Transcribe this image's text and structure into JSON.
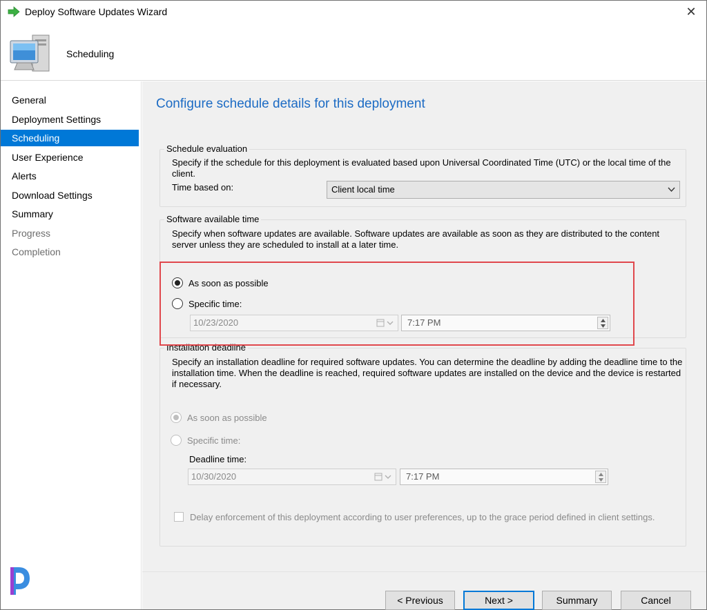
{
  "window": {
    "title": "Deploy Software Updates Wizard",
    "close_glyph": "✕"
  },
  "header": {
    "title": "Scheduling"
  },
  "sidebar": {
    "items": [
      {
        "label": "General",
        "state": "normal"
      },
      {
        "label": "Deployment Settings",
        "state": "normal"
      },
      {
        "label": "Scheduling",
        "state": "active"
      },
      {
        "label": "User Experience",
        "state": "normal"
      },
      {
        "label": "Alerts",
        "state": "normal"
      },
      {
        "label": "Download Settings",
        "state": "normal"
      },
      {
        "label": "Summary",
        "state": "normal"
      },
      {
        "label": "Progress",
        "state": "disabled"
      },
      {
        "label": "Completion",
        "state": "disabled"
      }
    ]
  },
  "main": {
    "heading": "Configure schedule details for this deployment",
    "schedule_evaluation": {
      "legend": "Schedule evaluation",
      "description": "Specify if the schedule for this deployment is evaluated based upon Universal Coordinated Time (UTC) or the local time of the client.",
      "time_based_on_label": "Time based on:",
      "time_based_on_value": "Client local time"
    },
    "software_available_time": {
      "legend": "Software available time",
      "description": "Specify when software updates are available. Software updates are available as soon as they are distributed to the content server unless they are scheduled to install at a later time.",
      "option_asap": "As soon as possible",
      "option_specific": "Specific time:",
      "selected": "asap",
      "date": "10/23/2020",
      "time": "7:17 PM"
    },
    "installation_deadline": {
      "legend": "Installation deadline",
      "description": "Specify an installation deadline for required software updates. You can determine the deadline by adding the deadline time to the installation time. When the deadline is reached, required software updates are installed on the device and the device is restarted if necessary.",
      "option_asap": "As soon as possible",
      "option_specific": "Specific time:",
      "deadline_label": "Deadline time:",
      "date": "10/30/2020",
      "time": "7:17 PM",
      "delay_checkbox_label": "Delay enforcement of this deployment according to user preferences, up to the grace period defined in client settings."
    }
  },
  "footer": {
    "previous": "< Previous",
    "next": "Next >",
    "summary": "Summary",
    "cancel": "Cancel"
  },
  "colors": {
    "accent": "#0078d7",
    "heading": "#1c6bc4",
    "highlight": "#e0474c"
  }
}
